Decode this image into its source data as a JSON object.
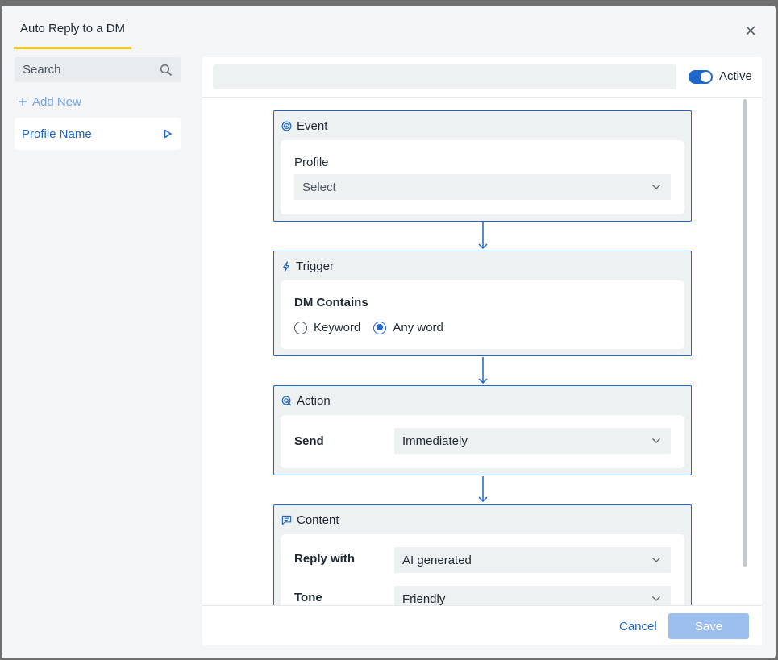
{
  "modal": {
    "tab_title": "Auto Reply to a DM"
  },
  "sidebar": {
    "search_placeholder": "Search",
    "add_new": "Add New",
    "items": [
      {
        "label": "Profile Name"
      }
    ]
  },
  "header": {
    "name_value": "",
    "active_label": "Active",
    "active": true
  },
  "event": {
    "title": "Event",
    "profile_label": "Profile",
    "profile_placeholder": "Select"
  },
  "trigger": {
    "title": "Trigger",
    "dm_contains_label": "DM Contains",
    "options": [
      {
        "label": "Keyword",
        "checked": false
      },
      {
        "label": "Any word",
        "checked": true
      }
    ]
  },
  "action": {
    "title": "Action",
    "send_label": "Send",
    "send_value": "Immediately"
  },
  "content": {
    "title": "Content",
    "reply_with_label": "Reply with",
    "reply_with_value": "AI generated",
    "tone_label": "Tone",
    "tone_value": "Friendly"
  },
  "footer": {
    "cancel_label": "Cancel",
    "save_label": "Save"
  },
  "colors": {
    "accent": "#1e66c9",
    "tab_underline": "#f5c518",
    "save_disabled": "#9dbff0"
  }
}
